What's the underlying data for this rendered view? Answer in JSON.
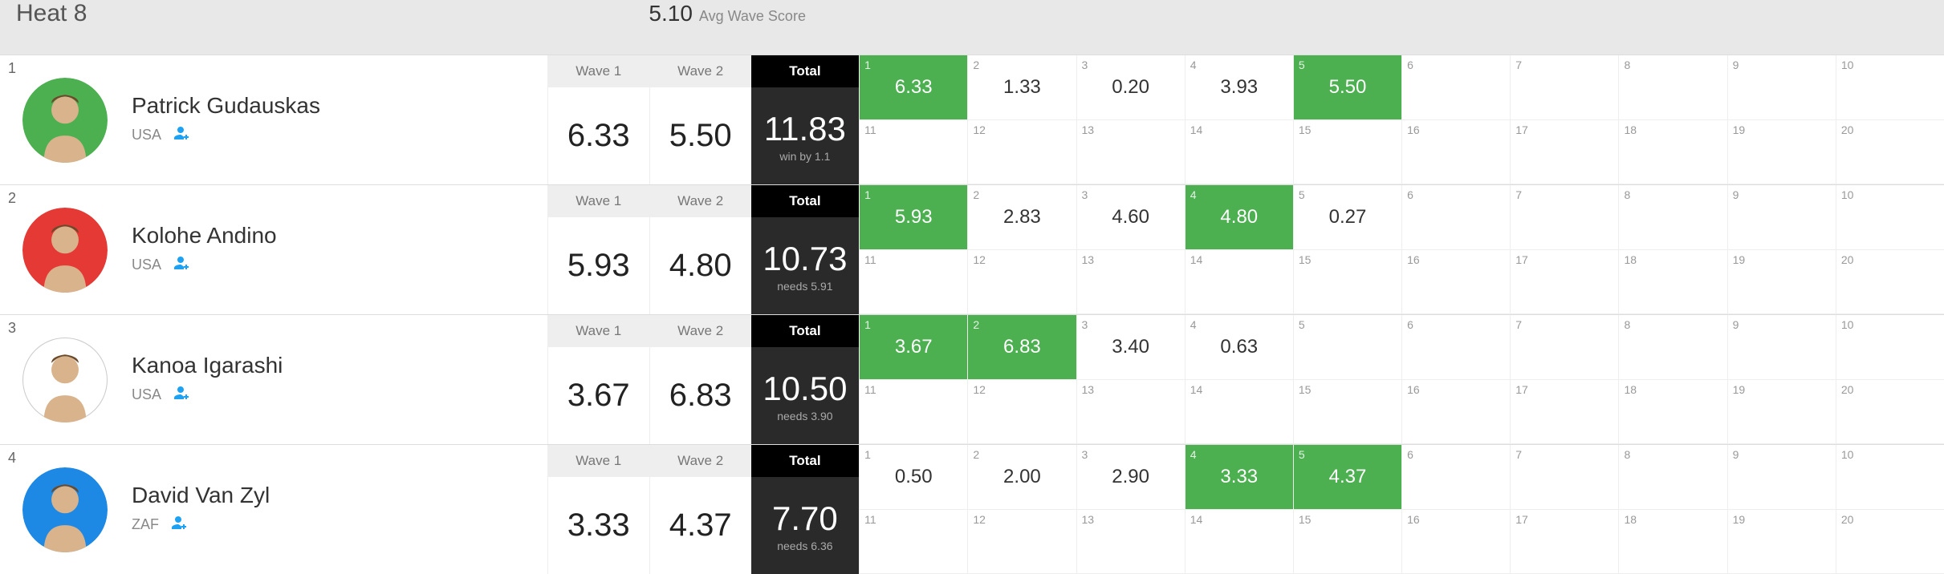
{
  "header": {
    "heat_title": "Heat 8",
    "avg_score": "5.10",
    "avg_label": "Avg Wave Score"
  },
  "col_labels": {
    "wave1": "Wave 1",
    "wave2": "Wave 2",
    "total": "Total"
  },
  "colors": {
    "green": "#4caf50",
    "red": "#e53935",
    "white": "#ffffff",
    "blue": "#1e88e5"
  },
  "surfers": [
    {
      "rank": "1",
      "name": "Patrick Gudauskas",
      "country": "USA",
      "jersey": "green",
      "wave1": "6.33",
      "wave2": "5.50",
      "total": "11.83",
      "status": "win by 1.1",
      "waves": [
        {
          "idx": "1",
          "score": "6.33",
          "hl": true
        },
        {
          "idx": "2",
          "score": "1.33",
          "hl": false
        },
        {
          "idx": "3",
          "score": "0.20",
          "hl": false
        },
        {
          "idx": "4",
          "score": "3.93",
          "hl": false
        },
        {
          "idx": "5",
          "score": "5.50",
          "hl": true
        },
        {
          "idx": "6",
          "score": "",
          "hl": false
        },
        {
          "idx": "7",
          "score": "",
          "hl": false
        },
        {
          "idx": "8",
          "score": "",
          "hl": false
        },
        {
          "idx": "9",
          "score": "",
          "hl": false
        },
        {
          "idx": "10",
          "score": "",
          "hl": false
        },
        {
          "idx": "11",
          "score": "",
          "hl": false
        },
        {
          "idx": "12",
          "score": "",
          "hl": false
        },
        {
          "idx": "13",
          "score": "",
          "hl": false
        },
        {
          "idx": "14",
          "score": "",
          "hl": false
        },
        {
          "idx": "15",
          "score": "",
          "hl": false
        },
        {
          "idx": "16",
          "score": "",
          "hl": false
        },
        {
          "idx": "17",
          "score": "",
          "hl": false
        },
        {
          "idx": "18",
          "score": "",
          "hl": false
        },
        {
          "idx": "19",
          "score": "",
          "hl": false
        },
        {
          "idx": "20",
          "score": "",
          "hl": false
        }
      ]
    },
    {
      "rank": "2",
      "name": "Kolohe Andino",
      "country": "USA",
      "jersey": "red",
      "wave1": "5.93",
      "wave2": "4.80",
      "total": "10.73",
      "status": "needs 5.91",
      "waves": [
        {
          "idx": "1",
          "score": "5.93",
          "hl": true
        },
        {
          "idx": "2",
          "score": "2.83",
          "hl": false
        },
        {
          "idx": "3",
          "score": "4.60",
          "hl": false
        },
        {
          "idx": "4",
          "score": "4.80",
          "hl": true
        },
        {
          "idx": "5",
          "score": "0.27",
          "hl": false
        },
        {
          "idx": "6",
          "score": "",
          "hl": false
        },
        {
          "idx": "7",
          "score": "",
          "hl": false
        },
        {
          "idx": "8",
          "score": "",
          "hl": false
        },
        {
          "idx": "9",
          "score": "",
          "hl": false
        },
        {
          "idx": "10",
          "score": "",
          "hl": false
        },
        {
          "idx": "11",
          "score": "",
          "hl": false
        },
        {
          "idx": "12",
          "score": "",
          "hl": false
        },
        {
          "idx": "13",
          "score": "",
          "hl": false
        },
        {
          "idx": "14",
          "score": "",
          "hl": false
        },
        {
          "idx": "15",
          "score": "",
          "hl": false
        },
        {
          "idx": "16",
          "score": "",
          "hl": false
        },
        {
          "idx": "17",
          "score": "",
          "hl": false
        },
        {
          "idx": "18",
          "score": "",
          "hl": false
        },
        {
          "idx": "19",
          "score": "",
          "hl": false
        },
        {
          "idx": "20",
          "score": "",
          "hl": false
        }
      ]
    },
    {
      "rank": "3",
      "name": "Kanoa Igarashi",
      "country": "USA",
      "jersey": "white",
      "wave1": "3.67",
      "wave2": "6.83",
      "total": "10.50",
      "status": "needs 3.90",
      "waves": [
        {
          "idx": "1",
          "score": "3.67",
          "hl": true
        },
        {
          "idx": "2",
          "score": "6.83",
          "hl": true
        },
        {
          "idx": "3",
          "score": "3.40",
          "hl": false
        },
        {
          "idx": "4",
          "score": "0.63",
          "hl": false
        },
        {
          "idx": "5",
          "score": "",
          "hl": false
        },
        {
          "idx": "6",
          "score": "",
          "hl": false
        },
        {
          "idx": "7",
          "score": "",
          "hl": false
        },
        {
          "idx": "8",
          "score": "",
          "hl": false
        },
        {
          "idx": "9",
          "score": "",
          "hl": false
        },
        {
          "idx": "10",
          "score": "",
          "hl": false
        },
        {
          "idx": "11",
          "score": "",
          "hl": false
        },
        {
          "idx": "12",
          "score": "",
          "hl": false
        },
        {
          "idx": "13",
          "score": "",
          "hl": false
        },
        {
          "idx": "14",
          "score": "",
          "hl": false
        },
        {
          "idx": "15",
          "score": "",
          "hl": false
        },
        {
          "idx": "16",
          "score": "",
          "hl": false
        },
        {
          "idx": "17",
          "score": "",
          "hl": false
        },
        {
          "idx": "18",
          "score": "",
          "hl": false
        },
        {
          "idx": "19",
          "score": "",
          "hl": false
        },
        {
          "idx": "20",
          "score": "",
          "hl": false
        }
      ]
    },
    {
      "rank": "4",
      "name": "David Van Zyl",
      "country": "ZAF",
      "jersey": "blue",
      "wave1": "3.33",
      "wave2": "4.37",
      "total": "7.70",
      "status": "needs 6.36",
      "waves": [
        {
          "idx": "1",
          "score": "0.50",
          "hl": false
        },
        {
          "idx": "2",
          "score": "2.00",
          "hl": false
        },
        {
          "idx": "3",
          "score": "2.90",
          "hl": false
        },
        {
          "idx": "4",
          "score": "3.33",
          "hl": true
        },
        {
          "idx": "5",
          "score": "4.37",
          "hl": true
        },
        {
          "idx": "6",
          "score": "",
          "hl": false
        },
        {
          "idx": "7",
          "score": "",
          "hl": false
        },
        {
          "idx": "8",
          "score": "",
          "hl": false
        },
        {
          "idx": "9",
          "score": "",
          "hl": false
        },
        {
          "idx": "10",
          "score": "",
          "hl": false
        },
        {
          "idx": "11",
          "score": "",
          "hl": false
        },
        {
          "idx": "12",
          "score": "",
          "hl": false
        },
        {
          "idx": "13",
          "score": "",
          "hl": false
        },
        {
          "idx": "14",
          "score": "",
          "hl": false
        },
        {
          "idx": "15",
          "score": "",
          "hl": false
        },
        {
          "idx": "16",
          "score": "",
          "hl": false
        },
        {
          "idx": "17",
          "score": "",
          "hl": false
        },
        {
          "idx": "18",
          "score": "",
          "hl": false
        },
        {
          "idx": "19",
          "score": "",
          "hl": false
        },
        {
          "idx": "20",
          "score": "",
          "hl": false
        }
      ]
    }
  ]
}
